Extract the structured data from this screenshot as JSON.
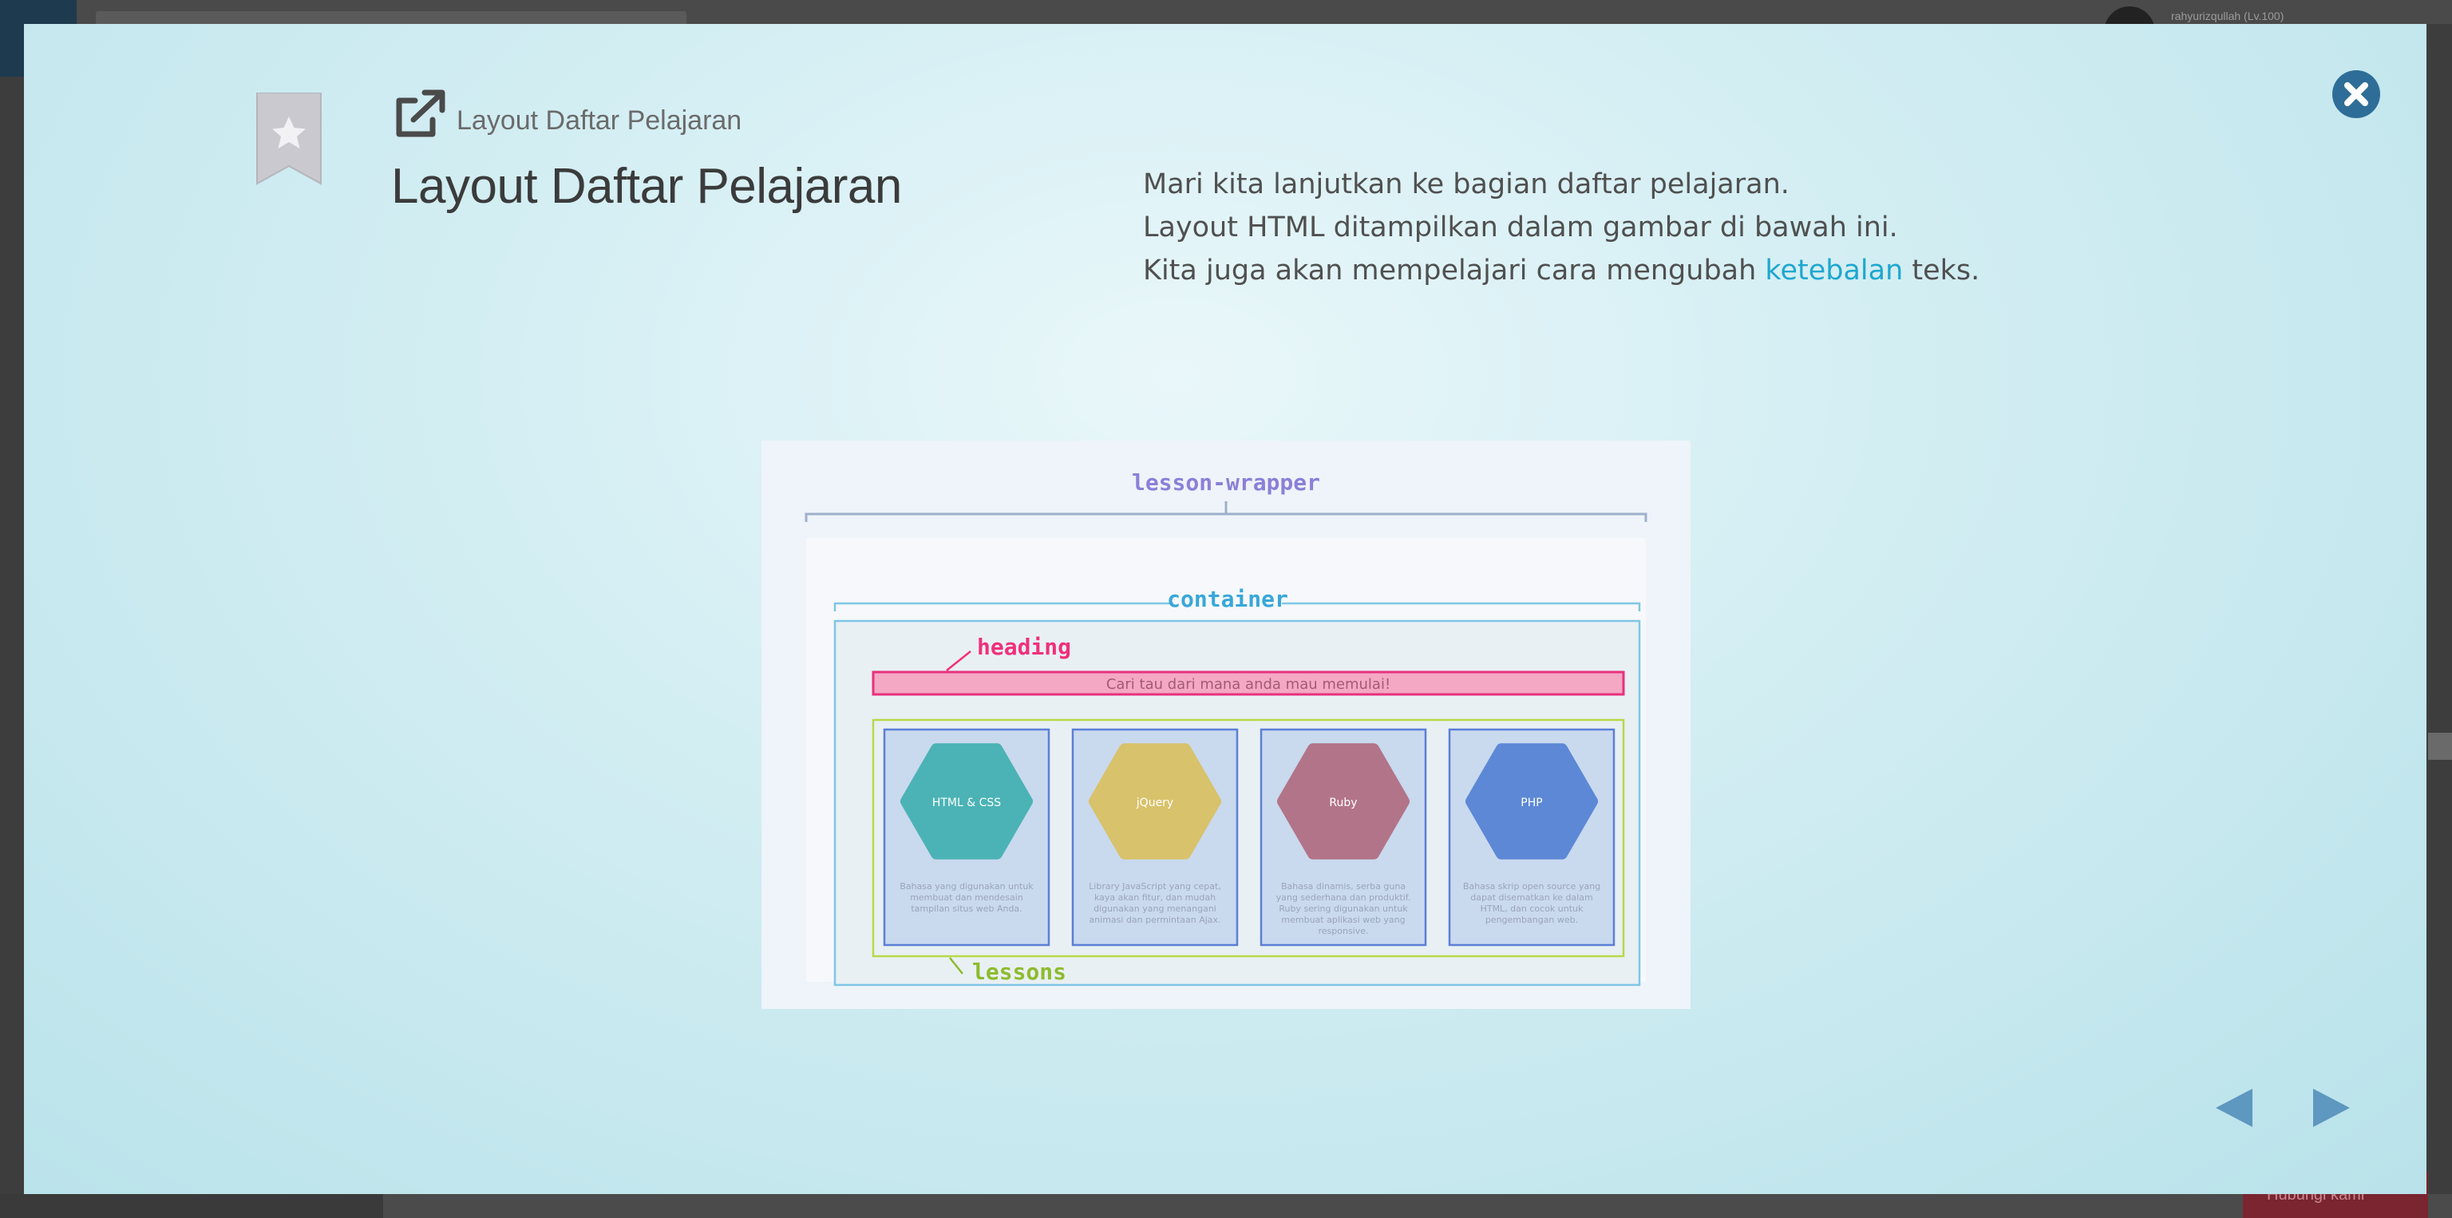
{
  "background": {
    "username": "rahyurizqullah (Lv.100)",
    "bottom_button": "Hubungi kami"
  },
  "modal": {
    "subtitle": "Layout Daftar Pelajaran",
    "title": "Layout Daftar Pelajaran",
    "description": {
      "line1": "Mari kita lanjutkan ke bagian daftar pelajaran.",
      "line2": "Layout HTML ditampilkan dalam gambar di bawah ini.",
      "line3_before": "Kita juga akan mempelajari cara mengubah ",
      "line3_highlight": "ketebalan",
      "line3_after": " teks."
    },
    "colors": {
      "accent": "#1fa7cf",
      "close": "#2e6d97",
      "nav": "#5e97bf"
    }
  },
  "diagram": {
    "label_wrapper": "lesson-wrapper",
    "label_container": "container",
    "label_heading": "heading",
    "label_lessons": "lessons",
    "heading_text": "Cari tau dari mana anda mau memulai!",
    "cards": [
      {
        "name": "HTML & CSS",
        "color": "#4bb3b5",
        "desc_1": "Bahasa yang digunakan untuk",
        "desc_2": "membuat dan mendesain",
        "desc_3": "tampilan situs web Anda.",
        "desc_4": "",
        "desc_5": ""
      },
      {
        "name": "jQuery",
        "color": "#d8c26b",
        "desc_1": "Library JavaScript yang cepat,",
        "desc_2": "kaya akan fitur, dan mudah",
        "desc_3": "digunakan yang menangani",
        "desc_4": "animasi dan permintaan Ajax.",
        "desc_5": ""
      },
      {
        "name": "Ruby",
        "color": "#b27488",
        "desc_1": "Bahasa dinamis, serba guna",
        "desc_2": "yang sederhana dan produktif.",
        "desc_3": "Ruby sering digunakan untuk",
        "desc_4": "membuat aplikasi web yang",
        "desc_5": "responsive."
      },
      {
        "name": "PHP",
        "color": "#5c88d6",
        "desc_1": "Bahasa skrip open source yang",
        "desc_2": "dapat disematkan ke dalam",
        "desc_3": "HTML, dan cocok untuk",
        "desc_4": "pengembangan web.",
        "desc_5": ""
      }
    ]
  }
}
